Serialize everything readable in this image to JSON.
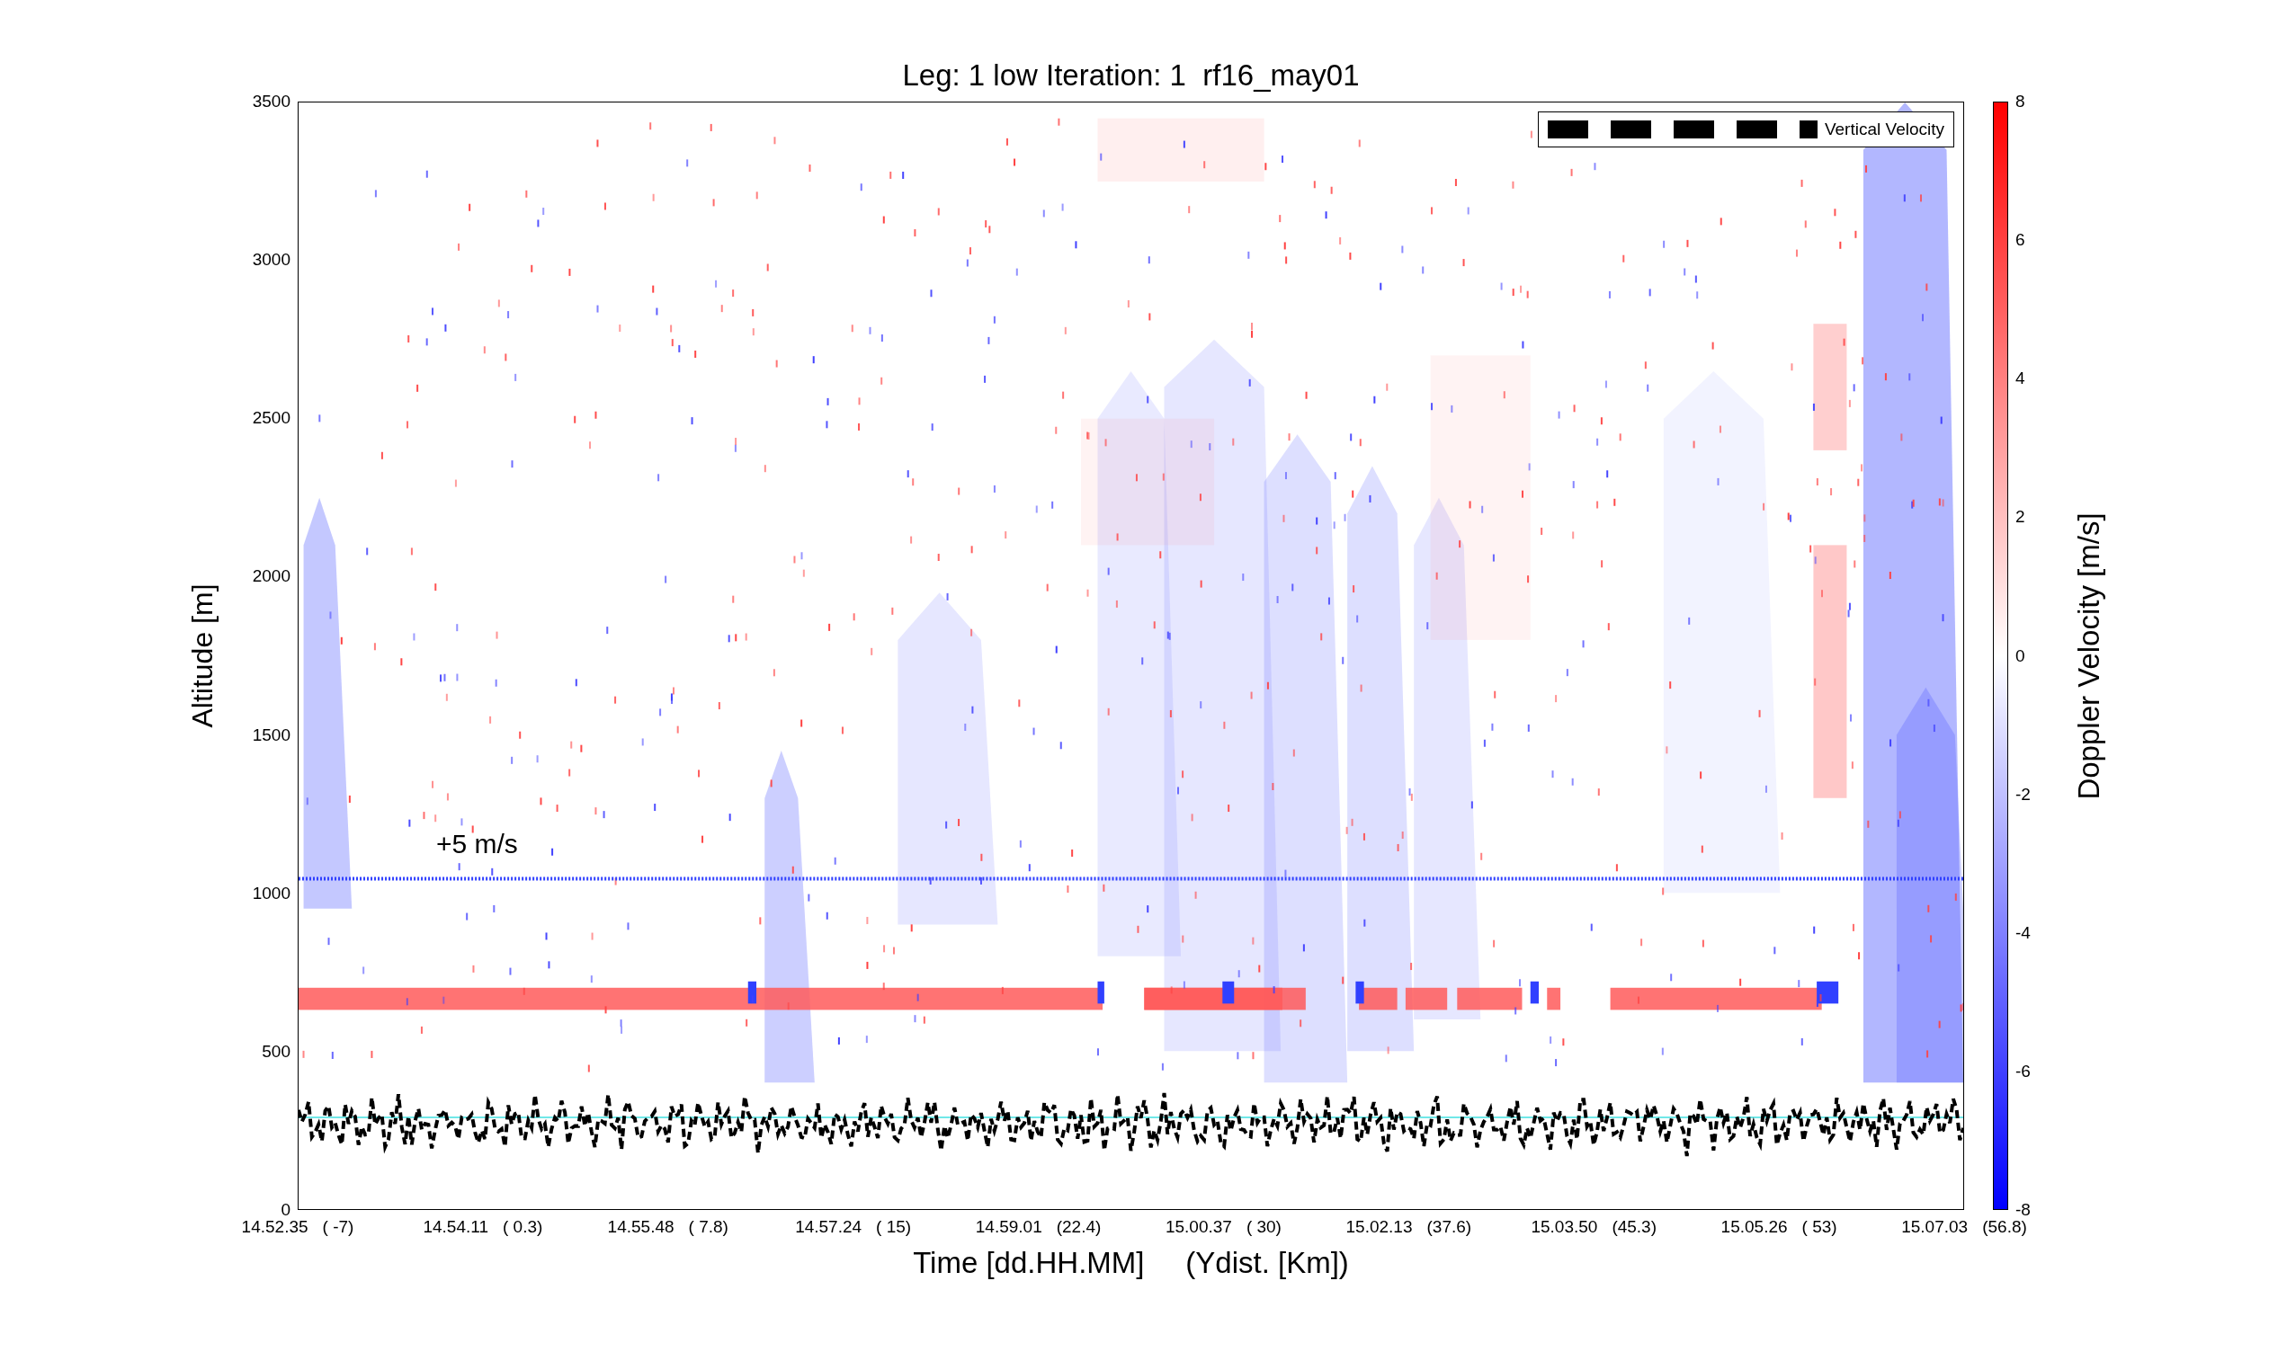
{
  "title": "Leg: 1 low Iteration: 1  rf16_may01",
  "plot": {
    "ylabel": "Altitude [m]",
    "yticks": [
      "3500",
      "3000",
      "2500",
      "2000",
      "1500",
      "1000",
      "500",
      "0"
    ],
    "xticks": [
      {
        "time": "14.52.35",
        "dist": "( -7)"
      },
      {
        "time": "14.54.11",
        "dist": "( 0.3)"
      },
      {
        "time": "14.55.48",
        "dist": "( 7.8)"
      },
      {
        "time": "14.57.24",
        "dist": "( 15)"
      },
      {
        "time": "14.59.01",
        "dist": "(22.4)"
      },
      {
        "time": "15.00.37",
        "dist": "( 30)"
      },
      {
        "time": "15.02.13",
        "dist": "(37.6)"
      },
      {
        "time": "15.03.50",
        "dist": "(45.3)"
      },
      {
        "time": "15.05.26",
        "dist": "( 53)"
      },
      {
        "time": "15.07.03",
        "dist": "(56.8)"
      }
    ],
    "xlabel": "Time [dd.HH.MM]     (Ydist. [Km])",
    "legend": {
      "label": "Vertical Velocity"
    },
    "annotation": "+5 m/s"
  },
  "colorbar": {
    "label": "Doppler Velocity [m/s]",
    "ticks": [
      "8",
      "6",
      "4",
      "2",
      "0",
      "-2",
      "-4",
      "-6",
      "-8"
    ]
  }
}
